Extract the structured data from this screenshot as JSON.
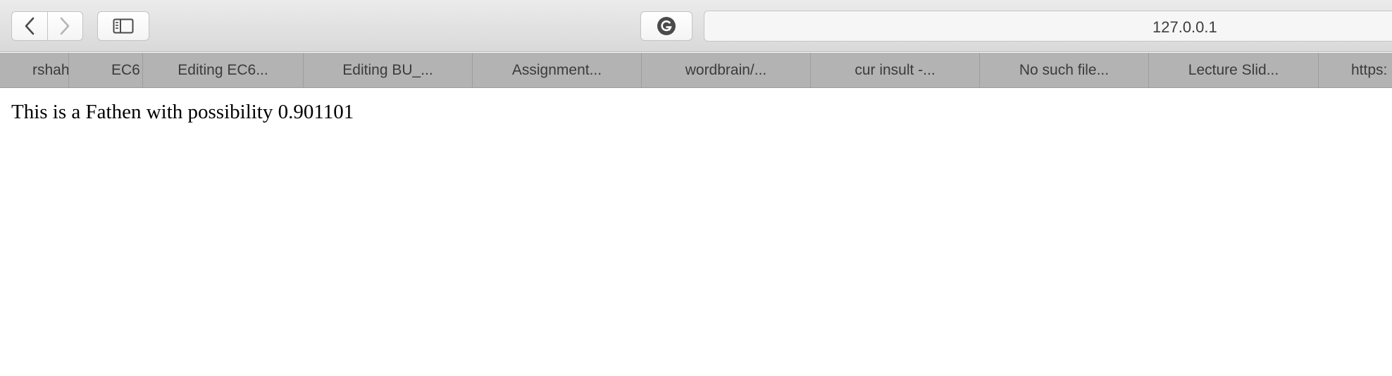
{
  "toolbar": {
    "back_icon": "chevron-left-icon",
    "forward_icon": "chevron-right-icon",
    "sidebar_icon": "sidebar-icon",
    "grammarly_icon": "grammarly-icon",
    "address": "127.0.0.1"
  },
  "tabs": [
    {
      "label": "rshah"
    },
    {
      "label": "EC6"
    },
    {
      "label": "Editing EC6..."
    },
    {
      "label": "Editing BU_..."
    },
    {
      "label": "Assignment..."
    },
    {
      "label": "wordbrain/..."
    },
    {
      "label": "cur insult -..."
    },
    {
      "label": "No such file..."
    },
    {
      "label": "Lecture Slid..."
    },
    {
      "label": "https:"
    }
  ],
  "page": {
    "text": "This is a Fathen with possibility 0.901101"
  }
}
